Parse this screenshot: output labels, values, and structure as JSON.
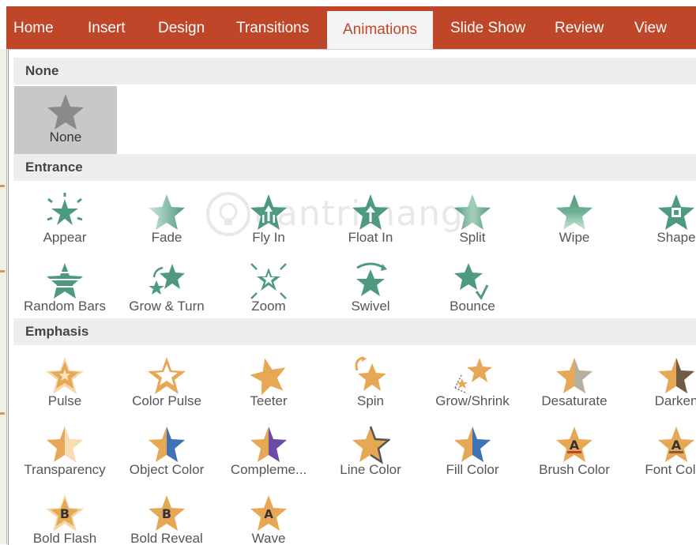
{
  "tabs": [
    {
      "label": "Home",
      "active": false
    },
    {
      "label": "Insert",
      "active": false
    },
    {
      "label": "Design",
      "active": false
    },
    {
      "label": "Transitions",
      "active": false
    },
    {
      "label": "Animations",
      "active": true
    },
    {
      "label": "Slide Show",
      "active": false
    },
    {
      "label": "Review",
      "active": false
    },
    {
      "label": "View",
      "active": false
    }
  ],
  "colors": {
    "ribbon": "#c0462a",
    "entrance": "#4e9a7e",
    "emphasis": "#e6a855",
    "emphasis_alt": "#6b4aa8",
    "none": "#8a8a8a"
  },
  "watermark": {
    "text": "uantrimang"
  },
  "sections": [
    {
      "title": "None",
      "items": [
        {
          "label": "None",
          "icon": "star-icon",
          "selected": true
        }
      ]
    },
    {
      "title": "Entrance",
      "items": [
        {
          "label": "Appear",
          "icon": "appear-icon"
        },
        {
          "label": "Fade",
          "icon": "fade-icon"
        },
        {
          "label": "Fly In",
          "icon": "fly-in-icon"
        },
        {
          "label": "Float In",
          "icon": "float-in-icon"
        },
        {
          "label": "Split",
          "icon": "split-icon"
        },
        {
          "label": "Wipe",
          "icon": "wipe-icon"
        },
        {
          "label": "Shape",
          "icon": "shape-icon"
        },
        {
          "label": "Random Bars",
          "icon": "random-bars-icon"
        },
        {
          "label": "Grow & Turn",
          "icon": "grow-turn-icon"
        },
        {
          "label": "Zoom",
          "icon": "zoom-icon"
        },
        {
          "label": "Swivel",
          "icon": "swivel-icon"
        },
        {
          "label": "Bounce",
          "icon": "bounce-icon"
        }
      ]
    },
    {
      "title": "Emphasis",
      "items": [
        {
          "label": "Pulse",
          "icon": "pulse-icon"
        },
        {
          "label": "Color Pulse",
          "icon": "color-pulse-icon"
        },
        {
          "label": "Teeter",
          "icon": "teeter-icon"
        },
        {
          "label": "Spin",
          "icon": "spin-icon"
        },
        {
          "label": "Grow/Shrink",
          "icon": "grow-shrink-icon"
        },
        {
          "label": "Desaturate",
          "icon": "desaturate-icon"
        },
        {
          "label": "Darken",
          "icon": "darken-icon"
        },
        {
          "label": "Transparency",
          "icon": "transparency-icon"
        },
        {
          "label": "Object Color",
          "icon": "object-color-icon"
        },
        {
          "label": "Compleme...",
          "icon": "complementary-color-icon"
        },
        {
          "label": "Line Color",
          "icon": "line-color-icon"
        },
        {
          "label": "Fill Color",
          "icon": "fill-color-icon"
        },
        {
          "label": "Brush Color",
          "icon": "brush-color-icon"
        },
        {
          "label": "Font Color",
          "icon": "font-color-icon"
        },
        {
          "label": "Bold Flash",
          "icon": "bold-flash-icon"
        },
        {
          "label": "Bold Reveal",
          "icon": "bold-reveal-icon"
        },
        {
          "label": "Wave",
          "icon": "wave-icon"
        }
      ]
    }
  ]
}
